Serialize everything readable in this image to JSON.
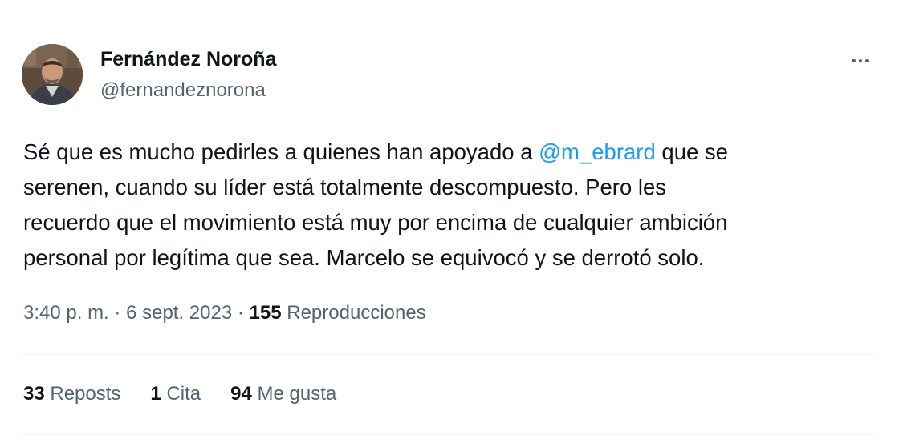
{
  "author": {
    "display_name": "Fernández Noroña",
    "handle": "@fernandeznorona",
    "avatar": "profile-photo"
  },
  "menu_icon": "more-horizontal-icon",
  "tweet": {
    "line1_before": "Sé que es mucho pedirles a quienes han apoyado a ",
    "mention": "@m_ebrard",
    "line1_after": " que se",
    "line2": "serenen, cuando su líder está totalmente descompuesto. Pero les",
    "line3": "recuerdo que el movimiento está muy por encima de cualquier ambición",
    "line4": "personal por legítima que sea. Marcelo se equivocó y se derrotó solo."
  },
  "meta": {
    "time": "3:40 p. m.",
    "separator": "·",
    "date": "6 sept. 2023",
    "views_count": "155",
    "views_label": "Reproducciones"
  },
  "stats": {
    "reposts_count": "33",
    "reposts_label": "Reposts",
    "quotes_count": "1",
    "quotes_label": "Cita",
    "likes_count": "94",
    "likes_label": "Me gusta"
  },
  "colors": {
    "text": "#0f1419",
    "secondary": "#536471",
    "link": "#1d9bf0",
    "divider": "#eff3f4"
  }
}
